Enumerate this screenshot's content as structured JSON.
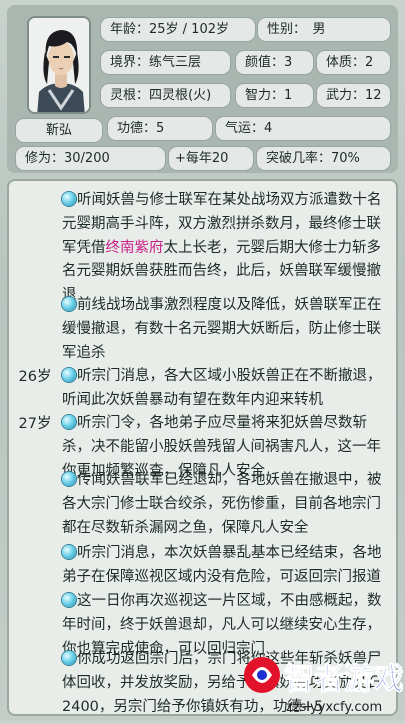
{
  "profile": {
    "age": "年龄：25岁 / 102岁",
    "gender": "性别：　男",
    "realm": "境界：练气三层",
    "appearance": "颜值：3",
    "physique": "体质：2",
    "spirit_root": "灵根：四灵根(火)",
    "intelligence": "智力：1",
    "martial": "武力：12",
    "name": "靳弘",
    "merit": "功德：5",
    "luck": "气运：4",
    "cultivation": "修为：30/200",
    "per_year": "+每年20",
    "breakthrough": "突破几率：70%"
  },
  "log": [
    {
      "age": "",
      "parts": [
        "听闻妖兽与修士联军在某处战场双方派遣数十名元婴期高手斗阵，双方激烈拼杀数月，最终修士联军凭借",
        "终南紫府",
        "太上长老，元婴后期大修士力斩多名元婴期妖兽获胜而告终，此后，妖兽联军缓慢撤退"
      ]
    },
    {
      "age": "",
      "parts": [
        "前线战场战事激烈程度以及降低，妖兽联军正在缓慢撤退，有数十名元婴期大妖断后，防止修士联军追杀"
      ]
    },
    {
      "age": "26岁",
      "parts": [
        "听宗门消息，各大区域小股妖兽正在不断撤退，听闻此次妖兽暴动有望在数年内迎来转机"
      ]
    },
    {
      "age": "27岁",
      "parts": [
        "听宗门令，各地弟子应尽量将来犯妖兽尽数斩杀，决不能留小股妖兽残留人间祸害凡人，这一年你更加频繁巡查，保障凡人安全"
      ]
    },
    {
      "age": "",
      "parts": [
        "传闻妖兽联军已经退却，各地妖兽在撤退中，被各大宗门修士联合绞杀，死伤惨重，目前各地宗门都在尽数斩杀漏网之鱼，保障凡人安全"
      ]
    },
    {
      "age": "",
      "parts": [
        "听宗门消息，本次妖兽暴乱基本已经结束，各地弟子在保障巡视区域内没有危险，可返回宗门报道"
      ]
    },
    {
      "age": "",
      "parts": [
        "这一日你再次巡视这一片区域，不由感概起，数年时间，终于妖兽退却，凡人可以继续安心生存，你也算完成使命，可以回归宗门"
      ]
    },
    {
      "age": "",
      "parts": [
        "你成功返回宗门后，宗门将你这些年斩杀妖兽尸体回收，并发放奖励，另给予你镇妖有功奖励灵石2400，另宗门给予你镇妖有功，功德+5"
      ]
    }
  ],
  "watermark": {
    "main": "智者游戏网",
    "url": "zzslyyxcfy.com"
  }
}
